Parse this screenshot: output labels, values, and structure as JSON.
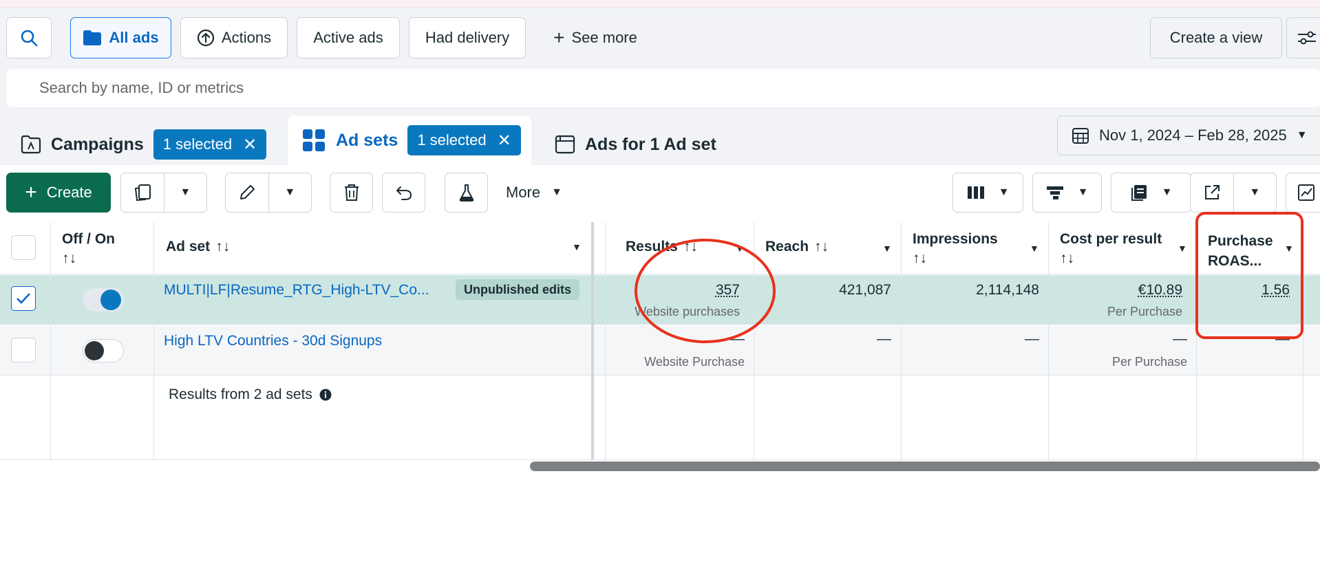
{
  "filters": {
    "all_ads": "All ads",
    "actions": "Actions",
    "active_ads": "Active ads",
    "had_delivery": "Had delivery",
    "see_more": "See more",
    "create_view": "Create a view"
  },
  "search": {
    "placeholder": "Search by name, ID or metrics"
  },
  "tabs": {
    "campaigns": {
      "label": "Campaigns",
      "chip": "1 selected"
    },
    "ad_sets": {
      "label": "Ad sets",
      "chip": "1 selected"
    },
    "ads": {
      "label": "Ads for 1 Ad set"
    }
  },
  "date_range": "Nov 1, 2024 – Feb 28, 2025",
  "toolbar": {
    "create": "Create",
    "more": "More"
  },
  "table": {
    "headers": {
      "off_on": "Off / On",
      "ad_set": "Ad set",
      "results": "Results",
      "reach": "Reach",
      "impressions": "Impressions",
      "cost_per_result": "Cost per result",
      "purchase_roas": "Purchase ROAS..."
    },
    "rows": [
      {
        "name": "MULTI|LF|Resume_RTG_High-LTV_Co...",
        "badge": "Unpublished edits",
        "results": "357",
        "results_sub": "Website purchases",
        "reach": "421,087",
        "impressions": "2,114,148",
        "cost": "€10.89",
        "cost_sub": "Per Purchase",
        "roas": "1.56",
        "selected": true,
        "on": true
      },
      {
        "name": "High LTV Countries - 30d Signups",
        "results": "—",
        "results_sub": "Website Purchase",
        "reach": "—",
        "impressions": "—",
        "cost": "—",
        "cost_sub": "Per Purchase",
        "roas": "—",
        "selected": false,
        "on": false
      }
    ],
    "summary": "Results from 2 ad sets"
  },
  "colors": {
    "accent": "#0a78be",
    "create_green": "#0b6b4f",
    "annotation_red": "#e8321e"
  }
}
